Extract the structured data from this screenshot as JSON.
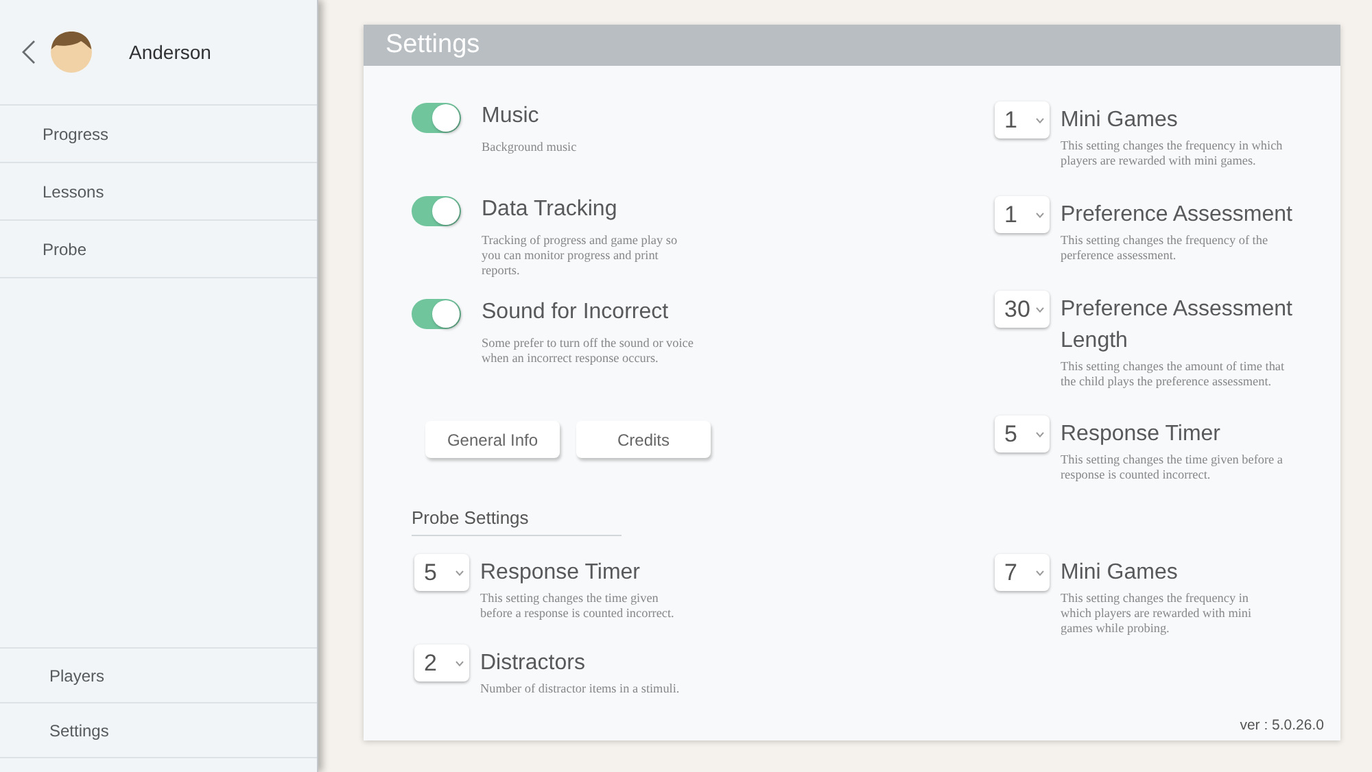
{
  "sidebar": {
    "user_name": "Anderson",
    "items": [
      {
        "label": "Progress"
      },
      {
        "label": "Lessons"
      },
      {
        "label": "Probe"
      }
    ],
    "footer_items": [
      {
        "label": "Players"
      },
      {
        "label": "Settings"
      }
    ]
  },
  "panel": {
    "title": "Settings",
    "toggles": [
      {
        "label": "Music",
        "description": "Background music",
        "on": true
      },
      {
        "label": "Data Tracking",
        "description": "Tracking of progress and game play so you can monitor progress and print reports.",
        "on": true
      },
      {
        "label": "Sound for Incorrect",
        "description": "Some prefer to turn off the sound or voice when an incorrect response occurs.",
        "on": true
      }
    ],
    "buttons": [
      "General Info",
      "Credits"
    ],
    "options": [
      {
        "value": "1",
        "label": "Mini Games",
        "description": "This setting changes the frequency in which players are rewarded with mini games."
      },
      {
        "value": "1",
        "label": "Preference Assessment",
        "description": "This setting changes the frequency of the perference assessment."
      },
      {
        "value": "30",
        "label": "Preference Assessment Length",
        "description": "This setting changes the amount of time that the child plays the preference assessment."
      },
      {
        "value": "5",
        "label": "Response Timer",
        "description": "This setting changes the time given before a response is counted incorrect."
      }
    ],
    "probe_settings": {
      "heading": "Probe Settings",
      "columns": [
        {
          "options": [
            {
              "value": "5",
              "label": "Response Timer",
              "description": "This setting changes the time given before a response is counted incorrect."
            },
            {
              "value": "2",
              "label": "Distractors",
              "description": "Number of distractor items in a stimuli."
            }
          ]
        },
        {
          "options": [
            {
              "value": "7",
              "label": "Mini Games",
              "description": "This setting changes the frequency in which players are rewarded with mini games while probing."
            }
          ]
        }
      ]
    },
    "version": "ver : 5.0.26.0"
  }
}
